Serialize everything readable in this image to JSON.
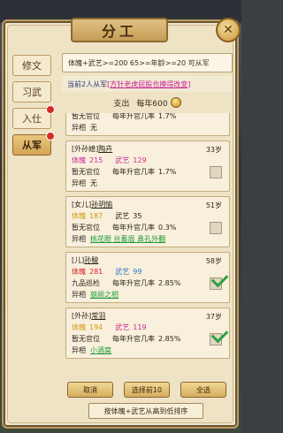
{
  "window": {
    "title": "分工",
    "close_symbol": "✕"
  },
  "side_tabs": [
    {
      "label": "修文",
      "active": false,
      "badge": false
    },
    {
      "label": "习武",
      "active": false,
      "badge": false
    },
    {
      "label": "入仕",
      "active": false,
      "badge": true
    },
    {
      "label": "从军",
      "active": true,
      "badge": true
    }
  ],
  "filter": {
    "text": "体魄+武艺>=200 65>=年龄>=20 可从军"
  },
  "info": {
    "prefix": "当前2人从军",
    "rest": "[方针老虎屁股也摸得改变]"
  },
  "pay": {
    "label": "支出",
    "value": "每年600"
  },
  "members": [
    {
      "partial": true,
      "office": "暂无官位",
      "rate_label": "每年升官几率",
      "rate": "1.7%",
      "trait_label": "异相",
      "trait": "无"
    },
    {
      "relation": "[外孙媳]",
      "name": "陶卉",
      "age": "33岁",
      "physique_label": "体魄",
      "physique": "215",
      "physique_color": "pink",
      "martial_label": "武艺",
      "martial": "129",
      "martial_color": "pink",
      "office": "暂无官位",
      "rate_label": "每年升官几率",
      "rate": "1.7%",
      "trait_label": "异相",
      "trait": "无",
      "trait_green": false,
      "checked": false
    },
    {
      "relation": "[女儿]",
      "name": "孙玥愉",
      "age": "51岁",
      "physique_label": "体魄",
      "physique": "187",
      "physique_color": "yellow",
      "martial_label": "武艺",
      "martial": "35",
      "martial_color": "none",
      "office": "暂无官位",
      "rate_label": "每年升官几率",
      "rate": "0.3%",
      "trait_label": "异相",
      "trait": "桃花眼  丝蓄眉  鼻孔外翻",
      "trait_green": true,
      "checked": false
    },
    {
      "relation": "[儿]",
      "name": "孙駿",
      "age": "58岁",
      "physique_label": "体魄",
      "physique": "281",
      "physique_color": "red",
      "martial_label": "武艺",
      "martial": "99",
      "martial_color": "blue",
      "office": "九品巡检",
      "rate_label": "每年升官几率",
      "rate": "2.85%",
      "trait_label": "异相",
      "trait": "狼顾之相",
      "trait_green": true,
      "checked": true
    },
    {
      "relation": "[外孙]",
      "name": "常羽",
      "age": "37岁",
      "physique_label": "体魄",
      "physique": "194",
      "physique_color": "yellow",
      "martial_label": "武艺",
      "martial": "119",
      "martial_color": "pink",
      "office": "暂无官位",
      "rate_label": "每年升官几率",
      "rate": "2.85%",
      "trait_label": "异相",
      "trait": "小酒窝",
      "trait_green": true,
      "checked": true
    }
  ],
  "buttons": {
    "cancel": "取消",
    "select_first": "选择前10",
    "select_all": "全选"
  },
  "sort": {
    "label": "按体魄+武艺从高到低排序"
  },
  "colors": {
    "pink": "#cc2a94",
    "yellow": "#d09a10",
    "red": "#d81e1e",
    "blue": "#2a76c8",
    "green": "#1f9a3a",
    "panel": "#f1e6cc"
  }
}
